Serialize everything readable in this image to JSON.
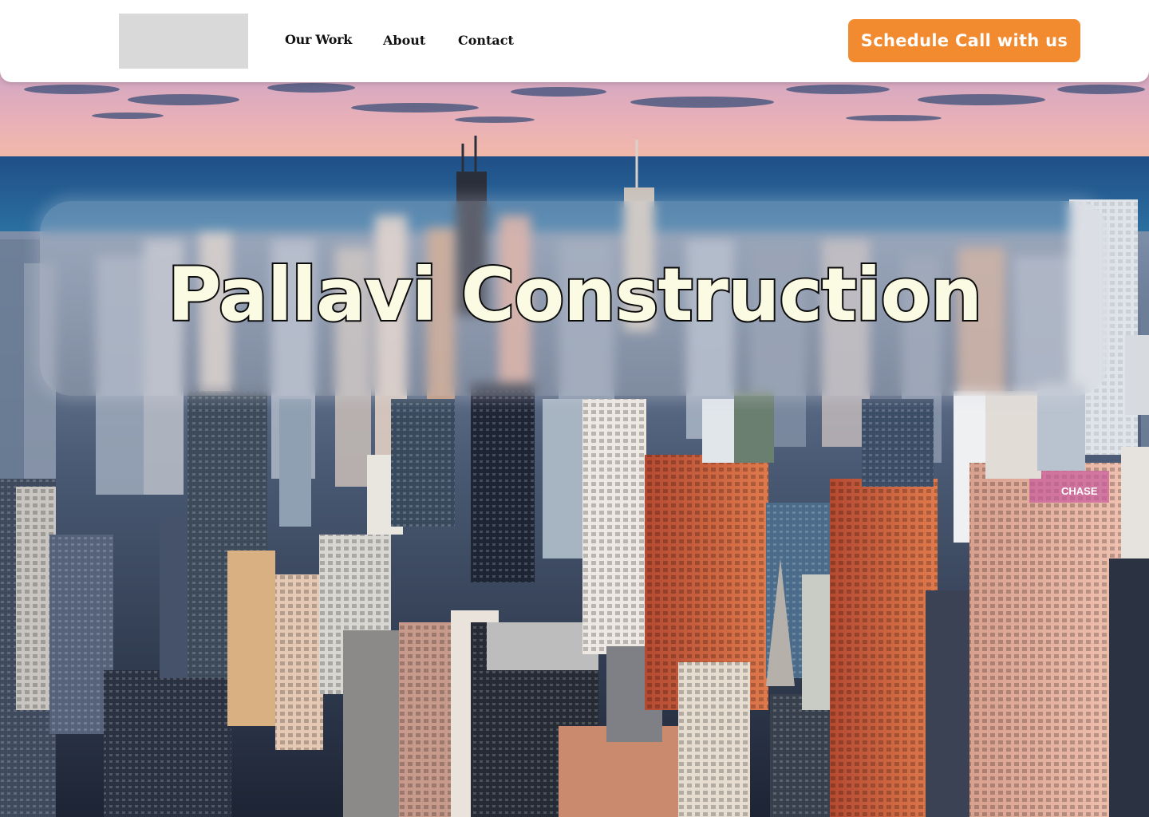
{
  "header": {
    "logo_icon": "logo-placeholder-icon",
    "nav": [
      {
        "label": "Our Work"
      },
      {
        "label": "About"
      },
      {
        "label": "Contact"
      }
    ],
    "cta_label": "Schedule Call with us"
  },
  "hero": {
    "title": "Pallavi Construction",
    "background": "aerial-city-skyline-photo",
    "sign_text": "CHASE"
  },
  "colors": {
    "accent": "#f28a30",
    "header_bg": "#ffffff",
    "title_fill": "#fbfbe4",
    "title_stroke": "#0b0b0b"
  }
}
